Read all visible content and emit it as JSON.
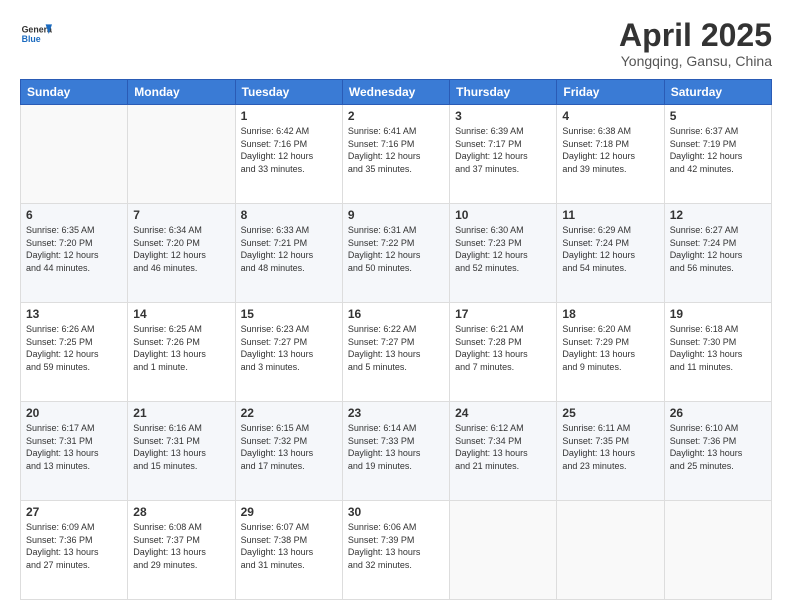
{
  "header": {
    "logo_line1": "General",
    "logo_line2": "Blue",
    "title": "April 2025",
    "subtitle": "Yongqing, Gansu, China"
  },
  "days_of_week": [
    "Sunday",
    "Monday",
    "Tuesday",
    "Wednesday",
    "Thursday",
    "Friday",
    "Saturday"
  ],
  "weeks": [
    [
      {
        "day": "",
        "info": ""
      },
      {
        "day": "",
        "info": ""
      },
      {
        "day": "1",
        "info": "Sunrise: 6:42 AM\nSunset: 7:16 PM\nDaylight: 12 hours\nand 33 minutes."
      },
      {
        "day": "2",
        "info": "Sunrise: 6:41 AM\nSunset: 7:16 PM\nDaylight: 12 hours\nand 35 minutes."
      },
      {
        "day": "3",
        "info": "Sunrise: 6:39 AM\nSunset: 7:17 PM\nDaylight: 12 hours\nand 37 minutes."
      },
      {
        "day": "4",
        "info": "Sunrise: 6:38 AM\nSunset: 7:18 PM\nDaylight: 12 hours\nand 39 minutes."
      },
      {
        "day": "5",
        "info": "Sunrise: 6:37 AM\nSunset: 7:19 PM\nDaylight: 12 hours\nand 42 minutes."
      }
    ],
    [
      {
        "day": "6",
        "info": "Sunrise: 6:35 AM\nSunset: 7:20 PM\nDaylight: 12 hours\nand 44 minutes."
      },
      {
        "day": "7",
        "info": "Sunrise: 6:34 AM\nSunset: 7:20 PM\nDaylight: 12 hours\nand 46 minutes."
      },
      {
        "day": "8",
        "info": "Sunrise: 6:33 AM\nSunset: 7:21 PM\nDaylight: 12 hours\nand 48 minutes."
      },
      {
        "day": "9",
        "info": "Sunrise: 6:31 AM\nSunset: 7:22 PM\nDaylight: 12 hours\nand 50 minutes."
      },
      {
        "day": "10",
        "info": "Sunrise: 6:30 AM\nSunset: 7:23 PM\nDaylight: 12 hours\nand 52 minutes."
      },
      {
        "day": "11",
        "info": "Sunrise: 6:29 AM\nSunset: 7:24 PM\nDaylight: 12 hours\nand 54 minutes."
      },
      {
        "day": "12",
        "info": "Sunrise: 6:27 AM\nSunset: 7:24 PM\nDaylight: 12 hours\nand 56 minutes."
      }
    ],
    [
      {
        "day": "13",
        "info": "Sunrise: 6:26 AM\nSunset: 7:25 PM\nDaylight: 12 hours\nand 59 minutes."
      },
      {
        "day": "14",
        "info": "Sunrise: 6:25 AM\nSunset: 7:26 PM\nDaylight: 13 hours\nand 1 minute."
      },
      {
        "day": "15",
        "info": "Sunrise: 6:23 AM\nSunset: 7:27 PM\nDaylight: 13 hours\nand 3 minutes."
      },
      {
        "day": "16",
        "info": "Sunrise: 6:22 AM\nSunset: 7:27 PM\nDaylight: 13 hours\nand 5 minutes."
      },
      {
        "day": "17",
        "info": "Sunrise: 6:21 AM\nSunset: 7:28 PM\nDaylight: 13 hours\nand 7 minutes."
      },
      {
        "day": "18",
        "info": "Sunrise: 6:20 AM\nSunset: 7:29 PM\nDaylight: 13 hours\nand 9 minutes."
      },
      {
        "day": "19",
        "info": "Sunrise: 6:18 AM\nSunset: 7:30 PM\nDaylight: 13 hours\nand 11 minutes."
      }
    ],
    [
      {
        "day": "20",
        "info": "Sunrise: 6:17 AM\nSunset: 7:31 PM\nDaylight: 13 hours\nand 13 minutes."
      },
      {
        "day": "21",
        "info": "Sunrise: 6:16 AM\nSunset: 7:31 PM\nDaylight: 13 hours\nand 15 minutes."
      },
      {
        "day": "22",
        "info": "Sunrise: 6:15 AM\nSunset: 7:32 PM\nDaylight: 13 hours\nand 17 minutes."
      },
      {
        "day": "23",
        "info": "Sunrise: 6:14 AM\nSunset: 7:33 PM\nDaylight: 13 hours\nand 19 minutes."
      },
      {
        "day": "24",
        "info": "Sunrise: 6:12 AM\nSunset: 7:34 PM\nDaylight: 13 hours\nand 21 minutes."
      },
      {
        "day": "25",
        "info": "Sunrise: 6:11 AM\nSunset: 7:35 PM\nDaylight: 13 hours\nand 23 minutes."
      },
      {
        "day": "26",
        "info": "Sunrise: 6:10 AM\nSunset: 7:36 PM\nDaylight: 13 hours\nand 25 minutes."
      }
    ],
    [
      {
        "day": "27",
        "info": "Sunrise: 6:09 AM\nSunset: 7:36 PM\nDaylight: 13 hours\nand 27 minutes."
      },
      {
        "day": "28",
        "info": "Sunrise: 6:08 AM\nSunset: 7:37 PM\nDaylight: 13 hours\nand 29 minutes."
      },
      {
        "day": "29",
        "info": "Sunrise: 6:07 AM\nSunset: 7:38 PM\nDaylight: 13 hours\nand 31 minutes."
      },
      {
        "day": "30",
        "info": "Sunrise: 6:06 AM\nSunset: 7:39 PM\nDaylight: 13 hours\nand 32 minutes."
      },
      {
        "day": "",
        "info": ""
      },
      {
        "day": "",
        "info": ""
      },
      {
        "day": "",
        "info": ""
      }
    ]
  ]
}
